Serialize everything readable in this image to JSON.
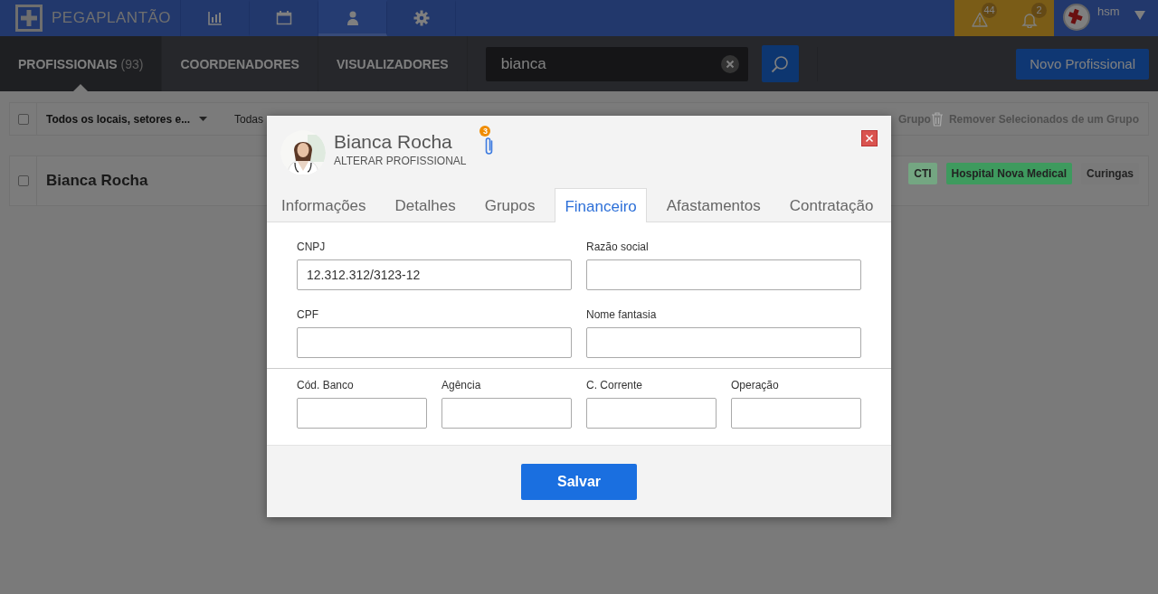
{
  "topbar": {
    "logo": "PEGAPLANTÃO",
    "nav": [
      {
        "kind": "chart",
        "selected": false
      },
      {
        "kind": "calendar",
        "selected": false
      },
      {
        "kind": "person",
        "selected": true
      },
      {
        "kind": "gear",
        "selected": false
      }
    ],
    "alerts": [
      {
        "kind": "warning",
        "count": "44"
      },
      {
        "kind": "bell",
        "count": "2"
      }
    ],
    "user": "hsm"
  },
  "subnav": {
    "tabs": [
      {
        "label": "PROFISSIONAIS",
        "count": "(93)",
        "selected": true
      },
      {
        "label": "COORDENADORES",
        "selected": false
      },
      {
        "label": "VISUALIZADORES",
        "selected": false
      }
    ],
    "search": {
      "value": "bianca"
    },
    "new_button": "Novo Profissional"
  },
  "toolbar": {
    "checked": false,
    "filter": "Todos os locais, setores e...",
    "filter_2": "Todas",
    "actions": [
      {
        "kind": "partial",
        "label": "Grupo"
      },
      {
        "kind": "remove",
        "label": "Remover Selecionados de um Grupo"
      }
    ]
  },
  "rows": [
    {
      "name": "Bianca Rocha",
      "checked": false,
      "tags": [
        {
          "label": "CTI",
          "color": "#74a682"
        },
        {
          "label": "Hospital Nova Medical",
          "color": "#3e9a5e"
        },
        {
          "label": "Curingas",
          "color": "#7a7a7a"
        }
      ]
    }
  ],
  "modal": {
    "name": "Bianca Rocha",
    "subtitle": "ALTERAR PROFISSIONAL",
    "attachments": "3",
    "tabs": [
      {
        "label": "Informações",
        "selected": false
      },
      {
        "label": "Detalhes",
        "selected": false
      },
      {
        "label": "Grupos",
        "selected": false
      },
      {
        "label": "Financeiro",
        "selected": true
      },
      {
        "label": "Afastamentos",
        "selected": false
      },
      {
        "label": "Contratação",
        "selected": false
      }
    ],
    "sections": [
      {
        "kind": "two",
        "fields": [
          {
            "label": "CNPJ",
            "value": "12.312.312/3123-12"
          },
          {
            "label": "Razão social"
          },
          {
            "label": "CPF"
          },
          {
            "label": "Nome fantasia"
          }
        ]
      },
      {
        "kind": "four",
        "fields": [
          {
            "label": "Cód. Banco"
          },
          {
            "label": "Agência"
          },
          {
            "label": "C. Corrente"
          },
          {
            "label": "Operação"
          }
        ]
      }
    ],
    "save": "Salvar"
  }
}
